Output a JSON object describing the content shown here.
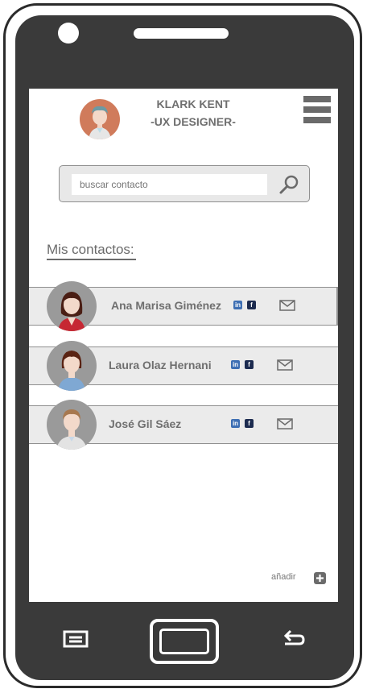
{
  "profile": {
    "name": "KLARK KENT",
    "role": "-UX DESIGNER-"
  },
  "search": {
    "placeholder": "buscar contacto"
  },
  "contacts_section": {
    "title": "Mis contactos:"
  },
  "contacts": [
    {
      "name": "Ana Marisa Giménez",
      "linkedin": "in",
      "facebook": "f"
    },
    {
      "name": "Laura Olaz Hernani",
      "linkedin": "in",
      "facebook": "f"
    },
    {
      "name": "José Gil Sáez",
      "linkedin": "in",
      "facebook": "f"
    }
  ],
  "add": {
    "label": "añadir"
  },
  "colors": {
    "linkedin": "#3e6fb3",
    "facebook": "#1c2b4f",
    "avatar_bg": "#d07b5b",
    "phone_body": "#3a3a3a"
  },
  "icons": [
    "menu-icon",
    "search-icon",
    "mail-icon",
    "plus-icon",
    "back-arrow-icon"
  ]
}
